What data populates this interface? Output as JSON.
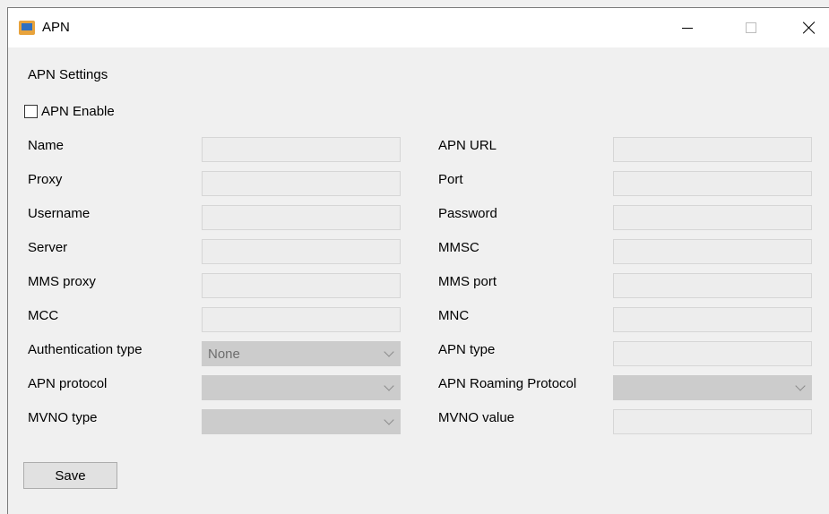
{
  "window": {
    "title": "APN",
    "icon": "app-window-icon",
    "controls": [
      "minimize-icon",
      "maximize-icon",
      "close-icon"
    ]
  },
  "section_title": "APN Settings",
  "apn_enable": {
    "label": "APN Enable",
    "checked": false
  },
  "left": {
    "name": "Name",
    "proxy": "Proxy",
    "username": "Username",
    "server": "Server",
    "mms_proxy": "MMS proxy",
    "mcc": "MCC",
    "auth_type": "Authentication type",
    "auth_type_value": "None",
    "apn_protocol": "APN protocol",
    "mvno_type": "MVNO type"
  },
  "right": {
    "apn_url": "APN URL",
    "port": "Port",
    "password": "Password",
    "mmsc": "MMSC",
    "mms_port": "MMS port",
    "mnc": "MNC",
    "apn_type": "APN type",
    "apn_roaming_protocol": "APN Roaming Protocol",
    "mvno_value": "MVNO value"
  },
  "save_label": "Save"
}
